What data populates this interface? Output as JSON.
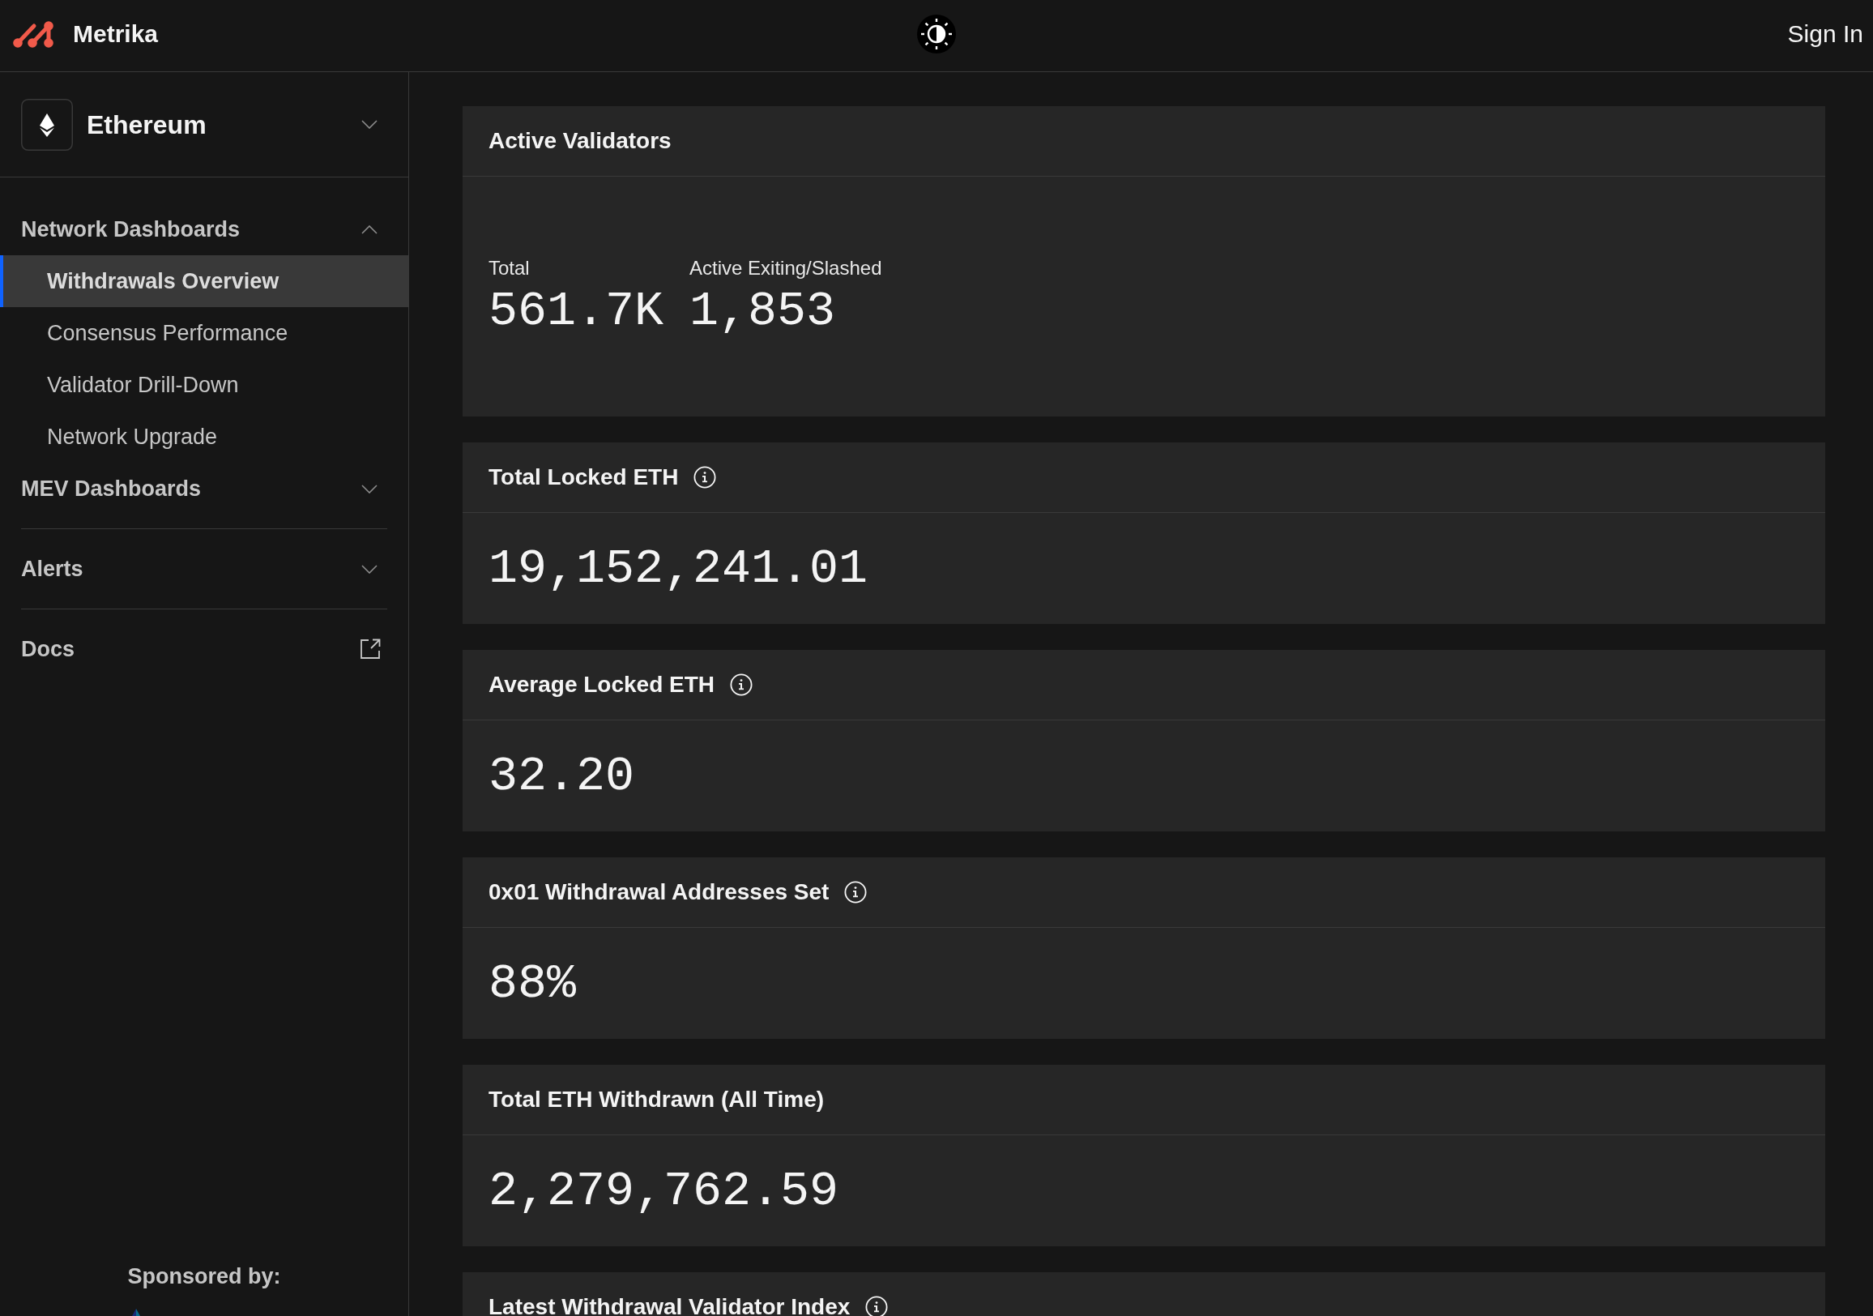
{
  "header": {
    "brand": "Metrika",
    "sign_in": "Sign In"
  },
  "sidebar": {
    "network": {
      "label": "Ethereum",
      "expanded": false
    },
    "sections": [
      {
        "kind": "group",
        "label": "Network Dashboards",
        "expanded": true,
        "items": [
          {
            "label": "Withdrawals Overview",
            "selected": true
          },
          {
            "label": "Consensus Performance",
            "selected": false
          },
          {
            "label": "Validator Drill-Down",
            "selected": false
          },
          {
            "label": "Network Upgrade",
            "selected": false
          }
        ]
      },
      {
        "kind": "group",
        "label": "MEV Dashboards",
        "expanded": false
      },
      {
        "kind": "group",
        "label": "Alerts",
        "expanded": false
      },
      {
        "kind": "link",
        "label": "Docs"
      }
    ],
    "sponsor": "Sponsored by:"
  },
  "cards": [
    {
      "kind": "stats",
      "title": "Active Validators",
      "info": false,
      "stats": [
        {
          "label": "Total",
          "value": "561.7K"
        },
        {
          "label": "Active Exiting/Slashed",
          "value": "1,853"
        }
      ]
    },
    {
      "kind": "value",
      "title": "Total Locked ETH",
      "info": true,
      "value": "19,152,241.01"
    },
    {
      "kind": "value",
      "title": "Average Locked ETH",
      "info": true,
      "value": "32.20"
    },
    {
      "kind": "value",
      "title": "0x01 Withdrawal Addresses Set",
      "info": true,
      "value": "88%"
    },
    {
      "kind": "value",
      "title": "Total ETH Withdrawn (All Time)",
      "info": false,
      "value": "2,279,762.59"
    },
    {
      "kind": "value",
      "title": "Latest Withdrawal Validator Index",
      "info": true
    }
  ]
}
